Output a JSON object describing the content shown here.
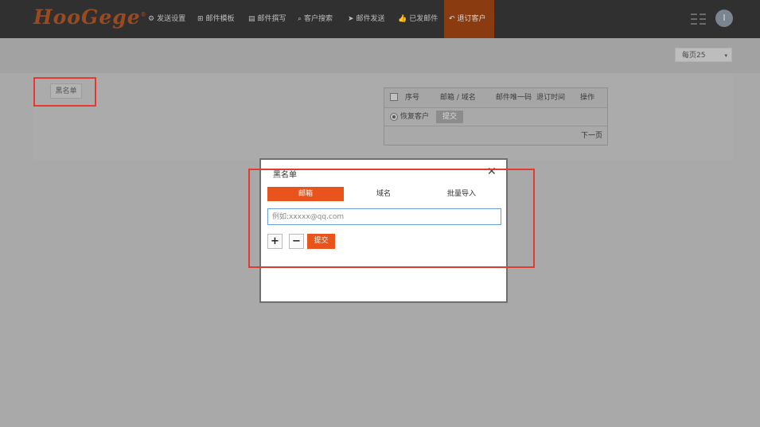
{
  "nav": {
    "logo": "HooGege",
    "logo_mark": "®",
    "items": [
      {
        "icon": "gear-icon",
        "glyph": "⚙",
        "label": "发送设置"
      },
      {
        "icon": "template-icon",
        "glyph": "⊞",
        "label": "邮件模板"
      },
      {
        "icon": "document-icon",
        "glyph": "▤",
        "label": "邮件撰写"
      },
      {
        "icon": "search-icon",
        "glyph": "⌕",
        "label": "客户搜索"
      },
      {
        "icon": "send-icon",
        "glyph": "➤",
        "label": "邮件发送"
      },
      {
        "icon": "thumbs-up-icon",
        "glyph": "👍",
        "label": "已发邮件"
      },
      {
        "icon": "reply-icon",
        "glyph": "↶",
        "label": "退订客户"
      }
    ],
    "active_index": 6,
    "avatar_initial": "I"
  },
  "toolbar": {
    "per_page": "每页25",
    "per_page_caret": "▾"
  },
  "page": {
    "blacklist_button": "黑名单",
    "table": {
      "headers": [
        "序号",
        "邮箱 / 域名",
        "邮件唯一码",
        "退订时间",
        "操作"
      ],
      "restore_label": "恢复客户",
      "submit": "提交",
      "next_page": "下一页"
    }
  },
  "modal": {
    "title": "黑名单",
    "close_glyph": "✕",
    "tabs": [
      "邮箱",
      "域名",
      "批量导入"
    ],
    "active_tab": 0,
    "email_placeholder": "例如:xxxxx@qq.com",
    "plus": "+",
    "minus": "−",
    "submit": "提交"
  },
  "colors": {
    "accent": "#e8541c",
    "highlight": "#e53a30",
    "navbar": "#303030"
  }
}
